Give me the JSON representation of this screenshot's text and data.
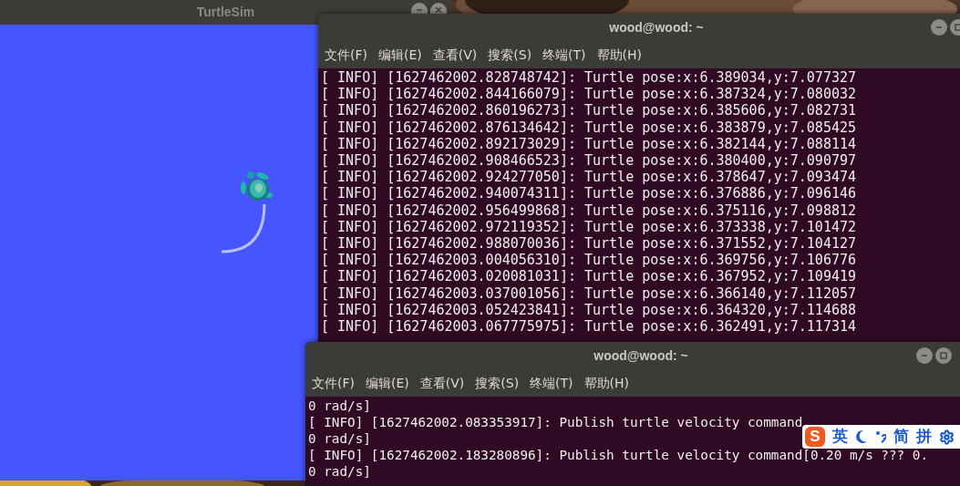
{
  "turtlesim": {
    "title": "TurtleSim"
  },
  "terminals": [
    {
      "title": "wood@wood: ~",
      "menu": [
        "文件(F)",
        "编辑(E)",
        "查看(V)",
        "搜索(S)",
        "终端(T)",
        "帮助(H)"
      ],
      "lines": [
        "[ INFO] [1627462002.828748742]: Turtle pose:x:6.389034,y:7.077327",
        "[ INFO] [1627462002.844166079]: Turtle pose:x:6.387324,y:7.080032",
        "[ INFO] [1627462002.860196273]: Turtle pose:x:6.385606,y:7.082731",
        "[ INFO] [1627462002.876134642]: Turtle pose:x:6.383879,y:7.085425",
        "[ INFO] [1627462002.892173029]: Turtle pose:x:6.382144,y:7.088114",
        "[ INFO] [1627462002.908466523]: Turtle pose:x:6.380400,y:7.090797",
        "[ INFO] [1627462002.924277050]: Turtle pose:x:6.378647,y:7.093474",
        "[ INFO] [1627462002.940074311]: Turtle pose:x:6.376886,y:7.096146",
        "[ INFO] [1627462002.956499868]: Turtle pose:x:6.375116,y:7.098812",
        "[ INFO] [1627462002.972119352]: Turtle pose:x:6.373338,y:7.101472",
        "[ INFO] [1627462002.988070036]: Turtle pose:x:6.371552,y:7.104127",
        "[ INFO] [1627462003.004056310]: Turtle pose:x:6.369756,y:7.106776",
        "[ INFO] [1627462003.020081031]: Turtle pose:x:6.367952,y:7.109419",
        "[ INFO] [1627462003.037001056]: Turtle pose:x:6.366140,y:7.112057",
        "[ INFO] [1627462003.052423841]: Turtle pose:x:6.364320,y:7.114688",
        "[ INFO] [1627462003.067775975]: Turtle pose:x:6.362491,y:7.117314"
      ]
    },
    {
      "title": "wood@wood: ~",
      "menu": [
        "文件(F)",
        "编辑(E)",
        "查看(V)",
        "搜索(S)",
        "终端(T)",
        "帮助(H)"
      ],
      "lines": [
        "0 rad/s]",
        "[ INFO] [1627462002.083353917]: Publish turtle velocity command",
        "0 rad/s]",
        "[ INFO] [1627462002.183280896]: Publish turtle velocity command[0.20 m/s ??? 0.",
        "0 rad/s]"
      ]
    }
  ],
  "ime_toolbar": {
    "logo": "S",
    "items": [
      {
        "kind": "text",
        "label": "英"
      },
      {
        "kind": "moon"
      },
      {
        "kind": "punctuation"
      },
      {
        "kind": "text",
        "label": "简"
      },
      {
        "kind": "text",
        "label": "拼"
      },
      {
        "kind": "gear"
      }
    ]
  }
}
